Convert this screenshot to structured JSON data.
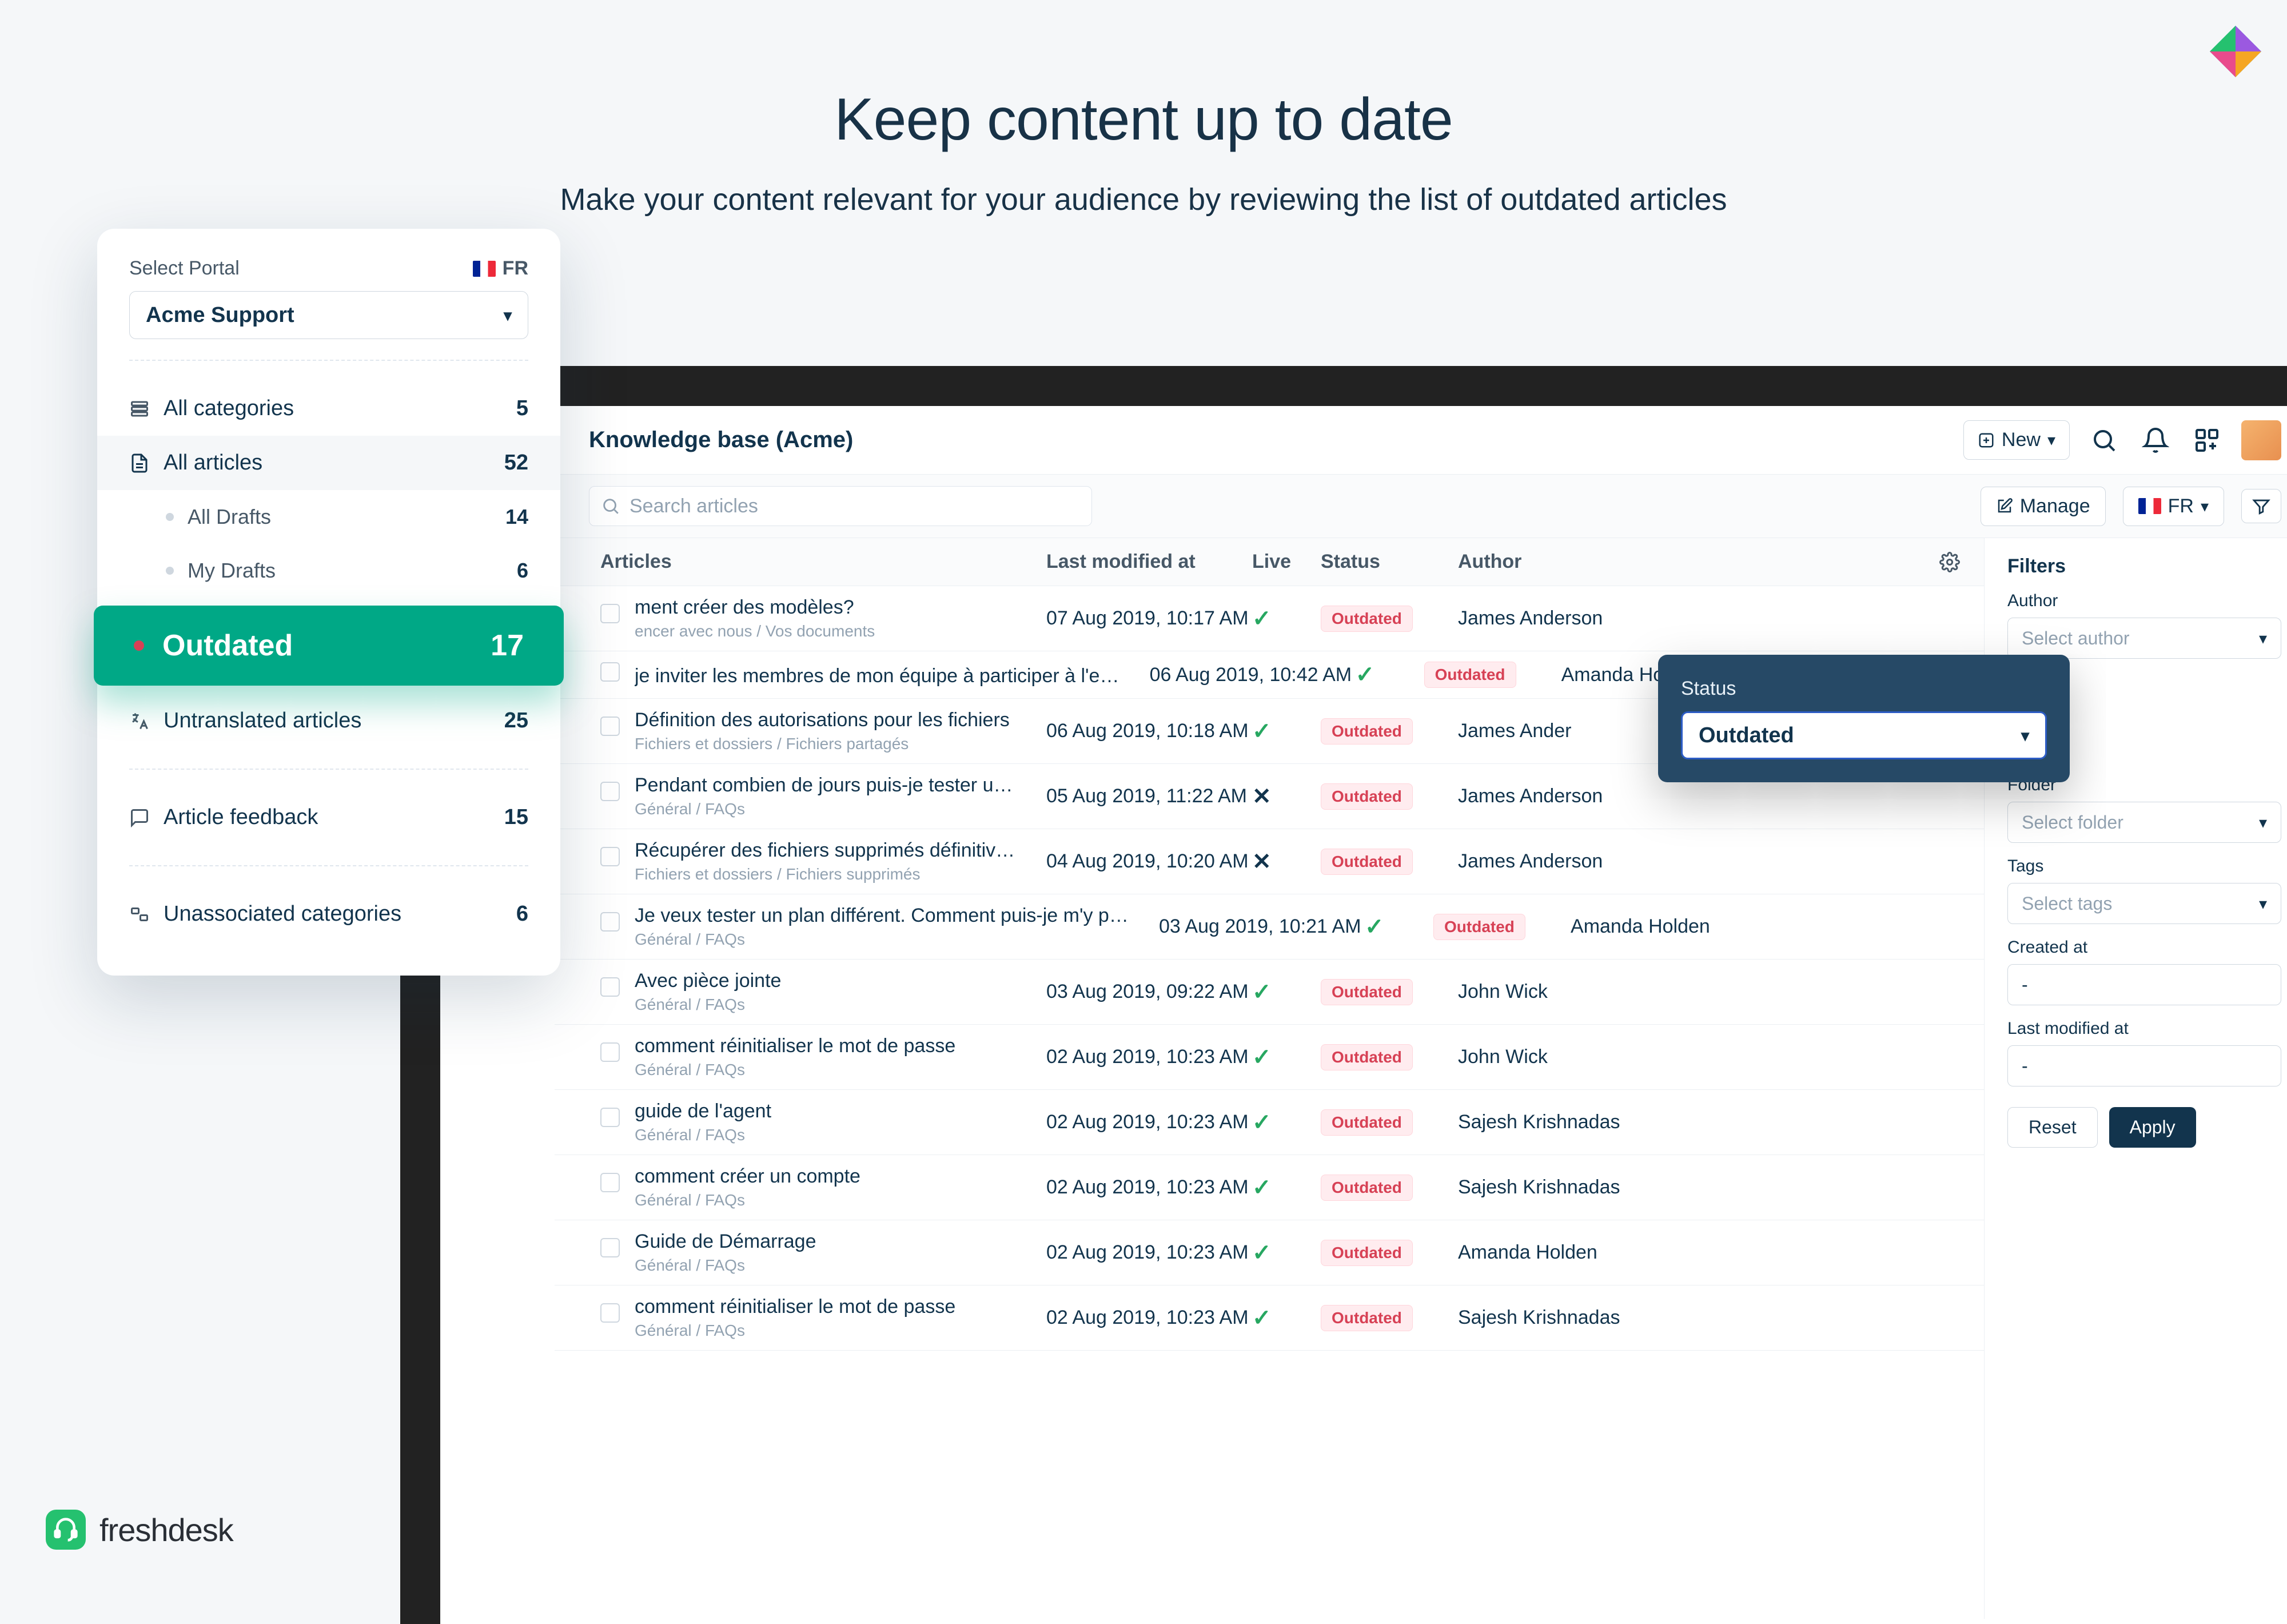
{
  "hero": {
    "title": "Keep content up to date",
    "subtitle": "Make your content relevant for your audience by reviewing the list of outdated articles"
  },
  "sidebar": {
    "selectPortalLabel": "Select Portal",
    "locale": "FR",
    "portal": "Acme Support",
    "items": {
      "allCategories": {
        "label": "All categories",
        "count": "5"
      },
      "allArticles": {
        "label": "All articles",
        "count": "52"
      },
      "allDrafts": {
        "label": "All Drafts",
        "count": "14"
      },
      "myDrafts": {
        "label": "My Drafts",
        "count": "6"
      },
      "outdated": {
        "label": "Outdated",
        "count": "17"
      },
      "untranslated": {
        "label": "Untranslated articles",
        "count": "25"
      },
      "feedback": {
        "label": "Article feedback",
        "count": "15"
      },
      "unassociated": {
        "label": "Unassociated categories",
        "count": "6"
      }
    }
  },
  "topbar": {
    "title": "Knowledge base (Acme)",
    "newBtn": "New"
  },
  "subbar": {
    "searchPlaceholder": "Search articles",
    "manageBtn": "Manage",
    "langBtn": "FR"
  },
  "table": {
    "headers": {
      "a": "Articles",
      "b": "Last modified at",
      "c": "Live",
      "d": "Status",
      "e": "Author"
    },
    "statusBadge": "Outdated",
    "rows": [
      {
        "title": "ment créer des modèles?",
        "path": "encer avec nous / Vos documents",
        "date": "07 Aug 2019, 10:17 AM",
        "live": true,
        "author": "James Anderson"
      },
      {
        "title": "je inviter les membres de mon équipe à participer à l'essai g...",
        "path": "",
        "date": "06 Aug 2019, 10:42 AM",
        "live": true,
        "author": "Amanda Ho"
      },
      {
        "title": "Définition des autorisations pour les fichiers",
        "path": "Fichiers et dossiers / Fichiers partagés",
        "date": "06 Aug 2019, 10:18 AM",
        "live": true,
        "author": "James Ander"
      },
      {
        "title": "Pendant combien de jours puis-je tester un plan?",
        "path": "Général / FAQs",
        "date": "05 Aug 2019, 11:22 AM",
        "live": false,
        "author": "James Anderson"
      },
      {
        "title": "Récupérer des fichiers supprimés définitivement",
        "path": "Fichiers et dossiers / Fichiers supprimés",
        "date": "04 Aug 2019, 10:20 AM",
        "live": false,
        "author": "James Anderson"
      },
      {
        "title": "Je veux tester un plan différent. Comment puis-je m'y prendre?",
        "path": "Général / FAQs",
        "date": "03 Aug 2019, 10:21 AM",
        "live": true,
        "author": "Amanda Holden"
      },
      {
        "title": "Avec pièce jointe",
        "path": "Général / FAQs",
        "date": "03 Aug 2019, 09:22 AM",
        "live": true,
        "author": "John Wick"
      },
      {
        "title": "comment réinitialiser le mot de passe",
        "path": "Général / FAQs",
        "date": "02 Aug 2019, 10:23 AM",
        "live": true,
        "author": "John Wick"
      },
      {
        "title": "guide de l'agent",
        "path": "Général / FAQs",
        "date": "02 Aug 2019, 10:23 AM",
        "live": true,
        "author": "Sajesh Krishnadas"
      },
      {
        "title": "comment créer un compte",
        "path": "Général / FAQs",
        "date": "02 Aug 2019, 10:23 AM",
        "live": true,
        "author": "Sajesh Krishnadas"
      },
      {
        "title": "Guide de Démarrage",
        "path": "Général / FAQs",
        "date": "02 Aug 2019, 10:23 AM",
        "live": true,
        "author": "Amanda Holden"
      },
      {
        "title": "comment réinitialiser le mot de passe",
        "path": "Général / FAQs",
        "date": "02 Aug 2019, 10:23 AM",
        "live": true,
        "author": "Sajesh Krishnadas"
      }
    ]
  },
  "filters": {
    "title": "Filters",
    "author": {
      "label": "Author",
      "placeholder": "Select author"
    },
    "folder": {
      "label": "Folder",
      "placeholder": "Select folder"
    },
    "tags": {
      "label": "Tags",
      "placeholder": "Select tags"
    },
    "createdAt": {
      "label": "Created at",
      "value": "-"
    },
    "lastModified": {
      "label": "Last modified at",
      "value": "-"
    },
    "reset": "Reset",
    "apply": "Apply"
  },
  "popover": {
    "label": "Status",
    "value": "Outdated"
  },
  "brand": "freshdesk"
}
